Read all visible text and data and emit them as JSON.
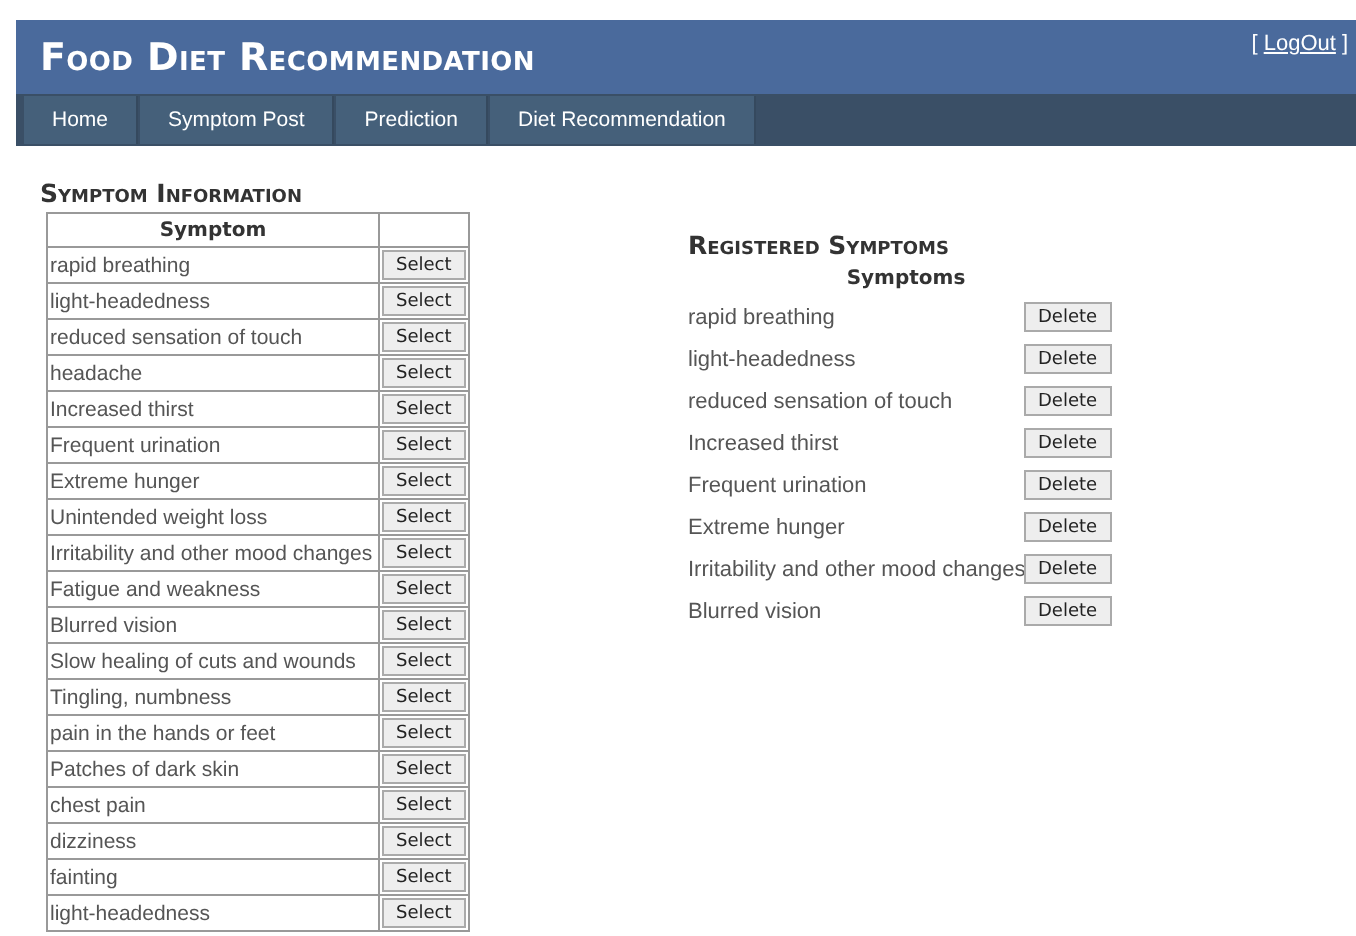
{
  "header": {
    "title": "Food Diet Recommendation",
    "login_prefix": "[",
    "logout_link": "LogOut",
    "login_suffix": "]"
  },
  "nav": [
    {
      "label": "Home"
    },
    {
      "label": "Symptom Post"
    },
    {
      "label": "Prediction"
    },
    {
      "label": "Diet Recommendation"
    }
  ],
  "symptom_information": {
    "title": "Symptom Information",
    "columns": [
      "Symptom"
    ],
    "rows": [
      {
        "symptom": "rapid breathing",
        "action": "Select"
      },
      {
        "symptom": "light-headedness",
        "action": "Select"
      },
      {
        "symptom": "reduced sensation of touch",
        "action": "Select"
      },
      {
        "symptom": "headache",
        "action": "Select"
      },
      {
        "symptom": "Increased thirst",
        "action": "Select"
      },
      {
        "symptom": "Frequent urination",
        "action": "Select"
      },
      {
        "symptom": "Extreme hunger",
        "action": "Select"
      },
      {
        "symptom": "Unintended weight loss",
        "action": "Select"
      },
      {
        "symptom": "Irritability and other mood changes",
        "action": "Select"
      },
      {
        "symptom": "Fatigue and weakness",
        "action": "Select"
      },
      {
        "symptom": "Blurred vision",
        "action": "Select"
      },
      {
        "symptom": "Slow healing of cuts and wounds",
        "action": "Select"
      },
      {
        "symptom": "Tingling, numbness",
        "action": "Select"
      },
      {
        "symptom": "pain in the hands or feet",
        "action": "Select"
      },
      {
        "symptom": "Patches of dark skin",
        "action": "Select"
      },
      {
        "symptom": "chest pain",
        "action": "Select"
      },
      {
        "symptom": "dizziness",
        "action": "Select"
      },
      {
        "symptom": "fainting",
        "action": "Select"
      },
      {
        "symptom": "light-headedness",
        "action": "Select"
      }
    ]
  },
  "registered_symptoms": {
    "title": "Registered Symptoms",
    "column": "Symptoms",
    "rows": [
      {
        "symptom": "rapid breathing",
        "action": "Delete"
      },
      {
        "symptom": "light-headedness",
        "action": "Delete"
      },
      {
        "symptom": "reduced sensation of touch",
        "action": "Delete"
      },
      {
        "symptom": "Increased thirst",
        "action": "Delete"
      },
      {
        "symptom": "Frequent urination",
        "action": "Delete"
      },
      {
        "symptom": "Extreme hunger",
        "action": "Delete"
      },
      {
        "symptom": "Irritability and other mood changes",
        "action": "Delete"
      },
      {
        "symptom": "Blurred vision",
        "action": "Delete"
      }
    ]
  }
}
